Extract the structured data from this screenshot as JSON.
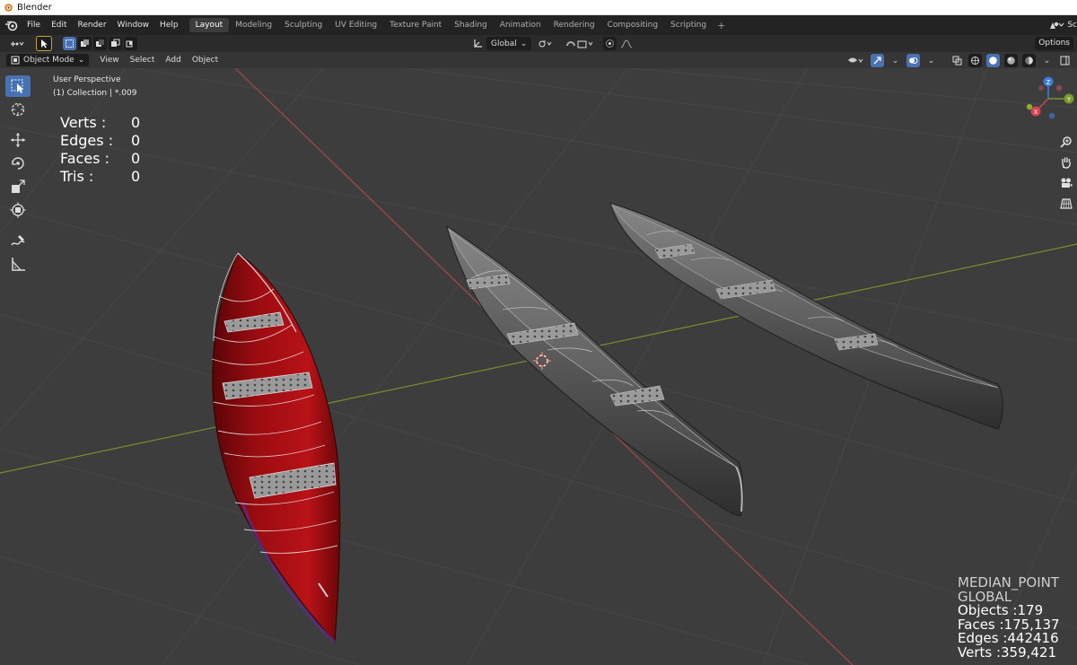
{
  "window": {
    "title": "Blender"
  },
  "topbar": {
    "menus": [
      "File",
      "Edit",
      "Render",
      "Window",
      "Help"
    ],
    "workspaces": [
      "Layout",
      "Modeling",
      "Sculpting",
      "UV Editing",
      "Texture Paint",
      "Shading",
      "Animation",
      "Rendering",
      "Compositing",
      "Scripting"
    ],
    "active_workspace": "Layout",
    "add_workspace": "+",
    "scene_label": "Sc"
  },
  "tool_header": {
    "orientation": "Global",
    "options": "Options"
  },
  "viewport_header": {
    "mode": "Object Mode",
    "menus": [
      "View",
      "Select",
      "Add",
      "Object"
    ]
  },
  "viewport": {
    "perspective": "User Perspective",
    "collection": "(1) Collection | *.009"
  },
  "stats_left": [
    {
      "label": "Verts :",
      "value": "0"
    },
    {
      "label": "Edges :",
      "value": "0"
    },
    {
      "label": "Faces :",
      "value": "0"
    },
    {
      "label": "Tris :",
      "value": "0"
    }
  ],
  "stats_right": {
    "pivot": "MEDIAN_POINT",
    "orientation": "GLOBAL",
    "objects": "Objects :179",
    "faces": "Faces :175,137",
    "edges": "Edges :442416",
    "verts": "Verts :359,421"
  },
  "gizmo": {
    "z": "Z",
    "y": "Y",
    "x": "X"
  },
  "colors": {
    "accent": "#4772b3",
    "canoe_red": "#b00e12",
    "canoe_grey": "#5c5c5c",
    "axis_x": "#b84747",
    "axis_y": "#7a9a2a",
    "axis_z": "#3d7cd6"
  },
  "icons": {
    "toolbar": [
      "select-box-icon",
      "cursor-icon",
      "move-icon",
      "rotate-icon",
      "scale-icon",
      "transform-icon",
      "annotate-icon",
      "measure-icon"
    ],
    "nav": [
      "zoom-icon",
      "pan-hand-icon",
      "camera-icon",
      "grid-view-icon"
    ]
  }
}
